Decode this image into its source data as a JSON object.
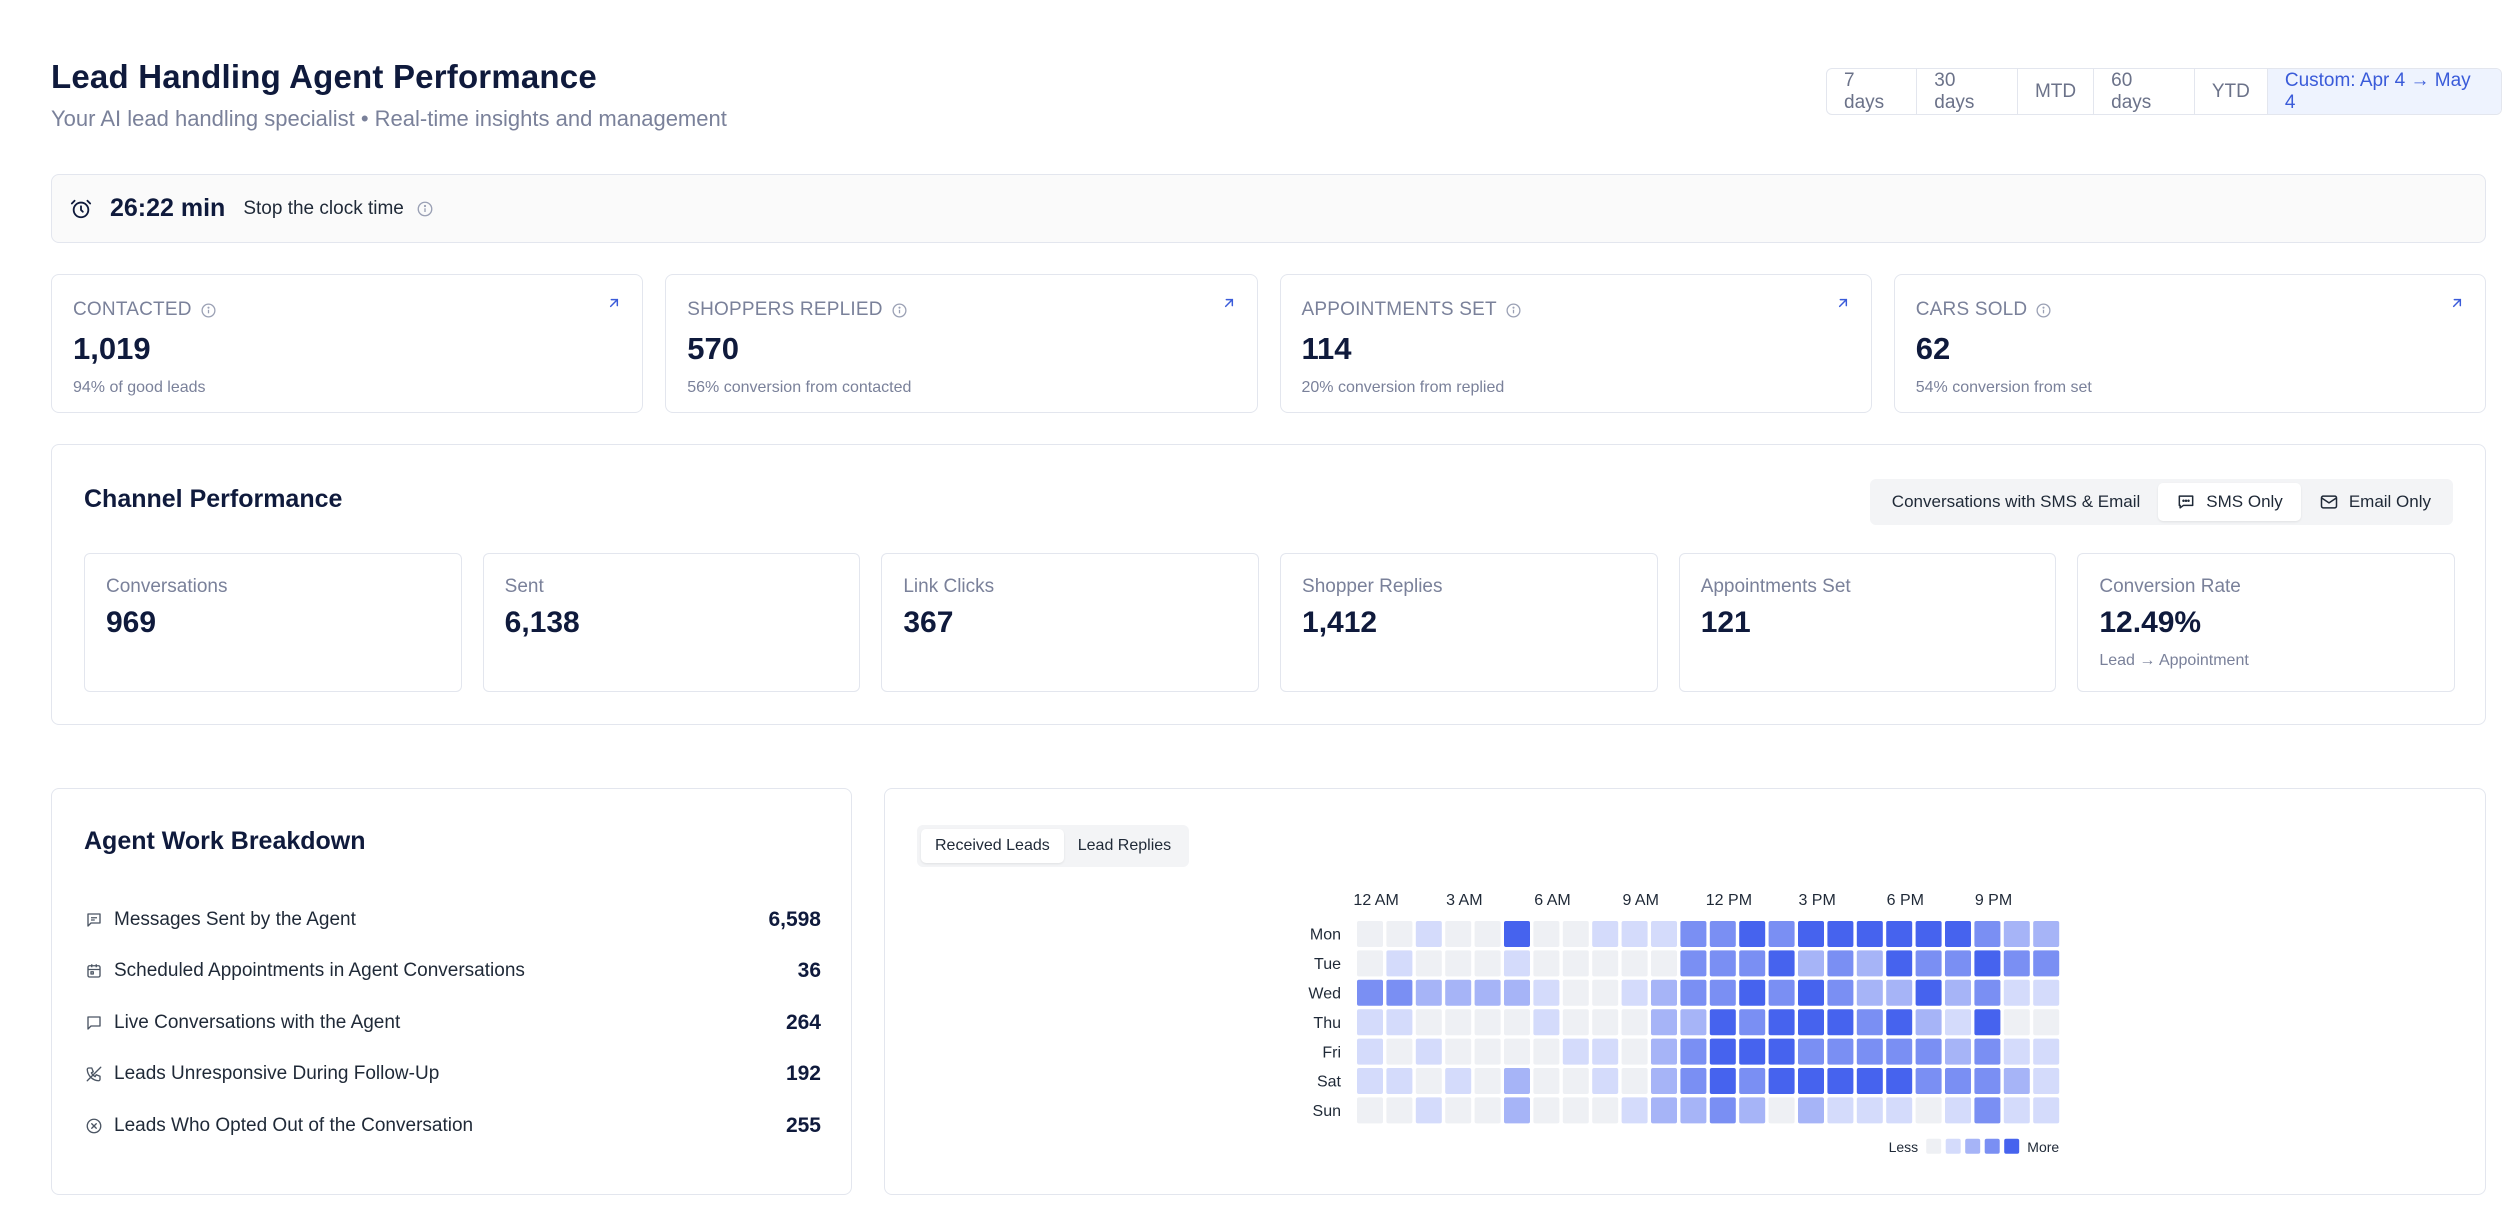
{
  "header": {
    "title": "Lead Handling Agent Performance",
    "subtitle": "Your AI lead handling specialist • Real-time insights and management"
  },
  "date_range": {
    "options": [
      "7 days",
      "30 days",
      "MTD",
      "60 days",
      "YTD",
      "Custom: Apr 4 → May 4"
    ],
    "selected": "Custom: Apr 4 → May 4"
  },
  "clock": {
    "value": "26:22 min",
    "label": "Stop the clock time"
  },
  "kpis": [
    {
      "label": "CONTACTED",
      "value": "1,019",
      "sub": "94% of good leads"
    },
    {
      "label": "SHOPPERS REPLIED",
      "value": "570",
      "sub": "56% conversion from contacted"
    },
    {
      "label": "APPOINTMENTS SET",
      "value": "114",
      "sub": "20% conversion from replied"
    },
    {
      "label": "CARS SOLD",
      "value": "62",
      "sub": "54% conversion from set"
    }
  ],
  "channel": {
    "title": "Channel Performance",
    "toggle": [
      "Conversations with SMS & Email",
      "SMS Only",
      "Email Only"
    ],
    "selected": "SMS Only",
    "stats": [
      {
        "label": "Conversations",
        "value": "969",
        "sub": ""
      },
      {
        "label": "Sent",
        "value": "6,138",
        "sub": ""
      },
      {
        "label": "Link Clicks",
        "value": "367",
        "sub": ""
      },
      {
        "label": "Shopper Replies",
        "value": "1,412",
        "sub": ""
      },
      {
        "label": "Appointments Set",
        "value": "121",
        "sub": ""
      },
      {
        "label": "Conversion Rate",
        "value": "12.49%",
        "sub": "Lead → Appointment"
      }
    ]
  },
  "work": {
    "title": "Agent Work Breakdown",
    "items": [
      {
        "icon": "message-lines-icon",
        "label": "Messages Sent by the Agent",
        "value": "6,598"
      },
      {
        "icon": "calendar-icon",
        "label": "Scheduled Appointments in Agent Conversations",
        "value": "36"
      },
      {
        "icon": "chat-bubble-icon",
        "label": "Live Conversations with the Agent",
        "value": "264"
      },
      {
        "icon": "phone-off-icon",
        "label": "Leads Unresponsive During Follow-Up",
        "value": "192"
      },
      {
        "icon": "x-circle-icon",
        "label": "Leads Who Opted Out of the Conversation",
        "value": "255"
      }
    ]
  },
  "heatmap": {
    "tabs": [
      "Received Leads",
      "Lead Replies"
    ],
    "selected_tab": "Received Leads",
    "legend": {
      "less": "Less",
      "more": "More"
    },
    "colors": [
      "#eef0f4",
      "#d4dbfb",
      "#a6b4f7",
      "#7a8ff3",
      "#4663ee"
    ]
  },
  "chart_data": {
    "type": "heatmap",
    "x_tick_labels": [
      "12 AM",
      "3 AM",
      "6 AM",
      "9 AM",
      "12 PM",
      "3 PM",
      "6 PM",
      "9 PM"
    ],
    "y": [
      "Mon",
      "Tue",
      "Wed",
      "Thu",
      "Fri",
      "Sat",
      "Sun"
    ],
    "x": [
      0,
      1,
      2,
      3,
      4,
      5,
      6,
      7,
      8,
      9,
      10,
      11,
      12,
      13,
      14,
      15,
      16,
      17,
      18,
      19,
      20,
      21,
      22,
      23
    ],
    "levels": [
      [
        0,
        0,
        1,
        0,
        0,
        4,
        0,
        0,
        1,
        1,
        1,
        3,
        3,
        4,
        3,
        4,
        4,
        4,
        4,
        4,
        4,
        3,
        2,
        2
      ],
      [
        0,
        1,
        0,
        0,
        0,
        1,
        0,
        0,
        0,
        0,
        0,
        3,
        3,
        3,
        4,
        2,
        3,
        2,
        4,
        3,
        3,
        4,
        3,
        3
      ],
      [
        3,
        3,
        2,
        2,
        2,
        2,
        1,
        0,
        0,
        1,
        2,
        3,
        3,
        4,
        3,
        4,
        3,
        2,
        2,
        4,
        2,
        3,
        1,
        1
      ],
      [
        1,
        1,
        0,
        0,
        0,
        0,
        1,
        0,
        0,
        0,
        2,
        2,
        4,
        3,
        4,
        4,
        4,
        3,
        4,
        2,
        1,
        4,
        0,
        0
      ],
      [
        1,
        0,
        1,
        0,
        0,
        0,
        0,
        1,
        1,
        0,
        2,
        3,
        4,
        4,
        4,
        3,
        3,
        3,
        3,
        3,
        2,
        3,
        1,
        1
      ],
      [
        1,
        1,
        0,
        1,
        0,
        2,
        0,
        0,
        1,
        0,
        2,
        3,
        4,
        3,
        4,
        4,
        4,
        4,
        4,
        3,
        3,
        3,
        2,
        1
      ],
      [
        0,
        0,
        1,
        0,
        0,
        2,
        0,
        0,
        0,
        1,
        2,
        2,
        3,
        2,
        0,
        2,
        1,
        1,
        1,
        0,
        1,
        3,
        1,
        1
      ]
    ],
    "level_range": [
      0,
      4
    ]
  }
}
